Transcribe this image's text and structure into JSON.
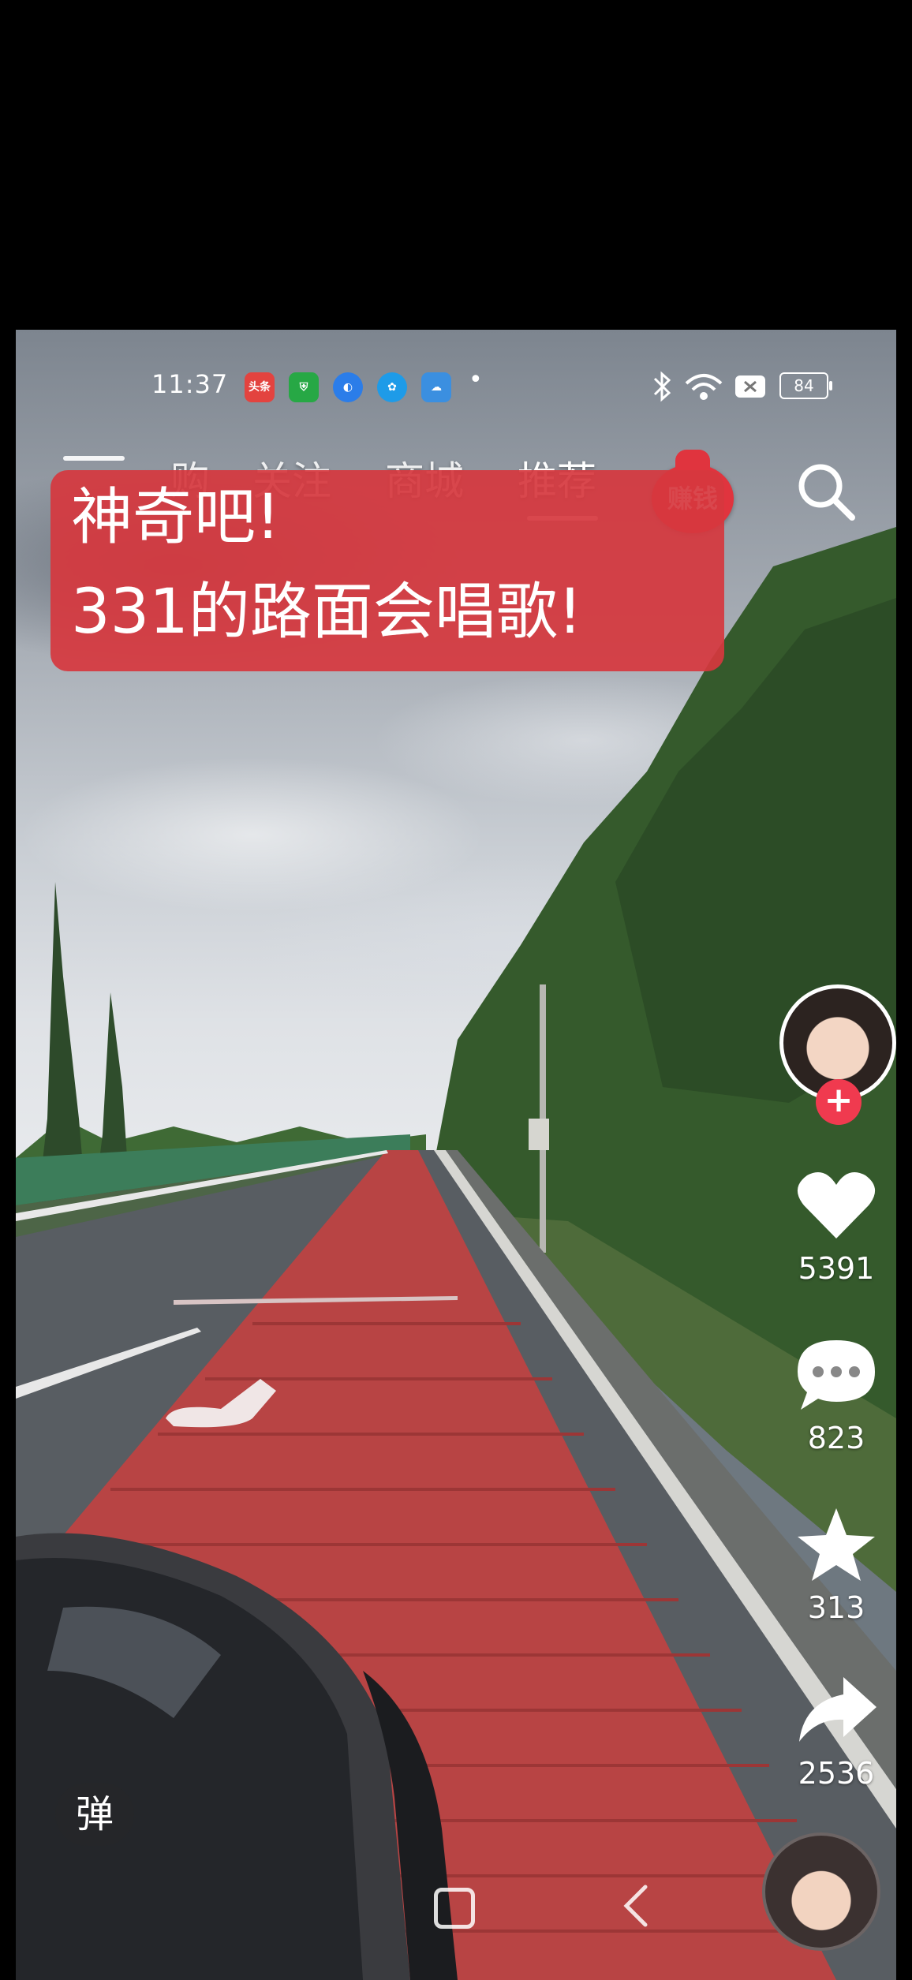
{
  "status_bar": {
    "time": "11:37",
    "apps": [
      {
        "name": "toutiao-app-icon",
        "label": "头条",
        "color": "#e3433f"
      },
      {
        "name": "shield-app-icon",
        "label": "",
        "color": "#27a845"
      },
      {
        "name": "browser-app-icon",
        "label": "",
        "color": "#2b7de9"
      },
      {
        "name": "china-mobile-app-icon",
        "label": "",
        "color": "#1e9be8"
      },
      {
        "name": "weather-app-icon",
        "label": "",
        "color": "#3b8fe0"
      }
    ],
    "battery": "84"
  },
  "top_nav": {
    "tabs": [
      {
        "label": "购"
      },
      {
        "label": "关注"
      },
      {
        "label": "商城"
      },
      {
        "label": "推荐"
      }
    ],
    "active_tab": "推荐",
    "earn_label": "赚钱"
  },
  "caption": {
    "line1": "神奇吧!",
    "line2": "331的路面会唱歌!"
  },
  "actions": {
    "likes": "5391",
    "comments": "823",
    "favorites": "313",
    "shares": "2536"
  },
  "danmaku_label": "弹",
  "colors": {
    "caption_bg": "#d6373e",
    "follow_plus": "#f03a4f",
    "road_red": "#b84444"
  }
}
